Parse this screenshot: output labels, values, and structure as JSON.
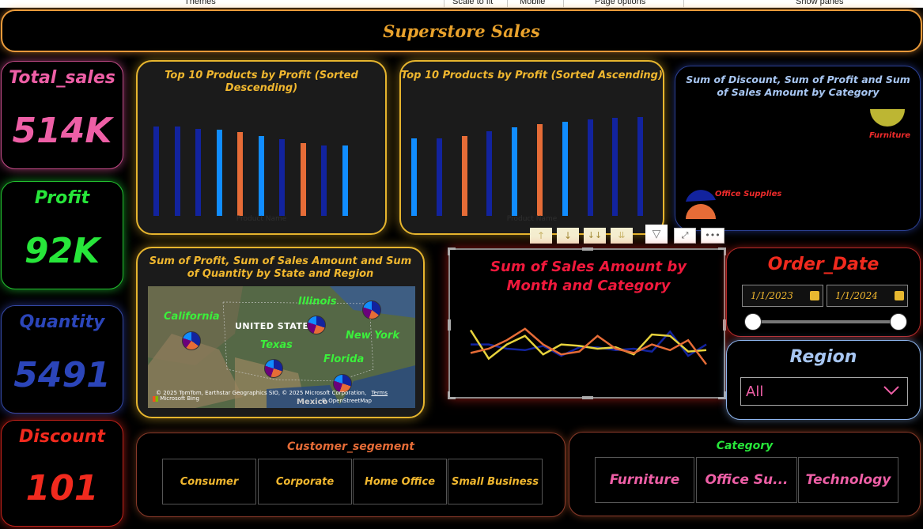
{
  "toolbar": {
    "themes": "Themes",
    "scale_to_fit": "Scale to fit",
    "mobile": "Mobile",
    "page_options": "Page options",
    "show_panes": "Show panes"
  },
  "report_title": "Superstore Sales",
  "kpis": {
    "total_sales": {
      "label": "Total_sales",
      "value": "514K",
      "color": "#ee5fa6"
    },
    "profit": {
      "label": "Profit",
      "value": "92K",
      "color": "#27e63a"
    },
    "quantity": {
      "label": "Quantity",
      "value": "5491",
      "color": "#2b45b9"
    },
    "discount": {
      "label": "Discount",
      "value": "101",
      "color": "#f12a1e"
    }
  },
  "top10_desc": {
    "title": "Top 10 Products by Profit (Sorted Descending)",
    "xlabel": "Product Name"
  },
  "top10_asc": {
    "title": "Top 10 Products by Profit (Sorted Ascending)",
    "xlabel": "Product Name"
  },
  "category_pie": {
    "title": "Sum of Discount, Sum of Profit and Sum of Sales Amount by Category",
    "label_furniture": "Furniture",
    "label_office_supplies": "Office Supplies"
  },
  "map_panel": {
    "title": "Sum of Profit, Sum of Sales Amount and Sum of Quantity by State and Region",
    "states": {
      "california": "California",
      "illinois": "Illinois",
      "texas": "Texas",
      "new_york": "New York",
      "florida": "Florida"
    },
    "country_label": "UNITED STATES",
    "mexico_label": "Mexico",
    "attribution": "© 2025 TomTom, Earthstar Geographics SIO, © 2025 Microsoft Corporation,",
    "terms": "Terms",
    "osm": "© OpenStreetMap",
    "bing": "Microsoft Bing"
  },
  "line_chart": {
    "title": "Sum of Sales Amount by Month and Category"
  },
  "order_date": {
    "label": "Order_Date",
    "start": "1/1/2023",
    "end": "1/1/2024"
  },
  "region": {
    "label": "Region",
    "selected": "All"
  },
  "customer_segment": {
    "label": "Customer_segement",
    "options": [
      "Consumer",
      "Corporate",
      "Home Office",
      "Small Business"
    ]
  },
  "category": {
    "label": "Category",
    "options": [
      "Furniture",
      "Office Su...",
      "Technology"
    ]
  },
  "colors": {
    "dark_blue": "#12239e",
    "light_blue": "#118dff",
    "orange": "#e66c37",
    "yellow": "#e7d33c",
    "gold": "#e6b52e"
  },
  "chart_data": [
    {
      "type": "bar",
      "title": "Top 10 Products by Profit (Sorted Descending)",
      "xlabel": "Product Name",
      "series": [
        {
          "values": [
            7.6,
            7.6,
            7.4,
            7.3,
            7.1,
            6.8,
            6.5,
            6.2,
            6.0,
            6.0
          ]
        }
      ],
      "bar_colors": [
        "#12239e",
        "#12239e",
        "#12239e",
        "#118dff",
        "#e66c37",
        "#118dff",
        "#12239e",
        "#e66c37",
        "#12239e",
        "#118dff"
      ],
      "ylim": [
        0,
        8.4
      ]
    },
    {
      "type": "bar",
      "title": "Top 10 Products by Profit (Sorted Ascending)",
      "xlabel": "Product Name",
      "series": [
        {
          "values": [
            6.6,
            6.6,
            6.8,
            7.2,
            7.5,
            7.8,
            8.0,
            8.2,
            8.3,
            8.4
          ]
        }
      ],
      "bar_colors": [
        "#118dff",
        "#12239e",
        "#e66c37",
        "#12239e",
        "#118dff",
        "#e66c37",
        "#118dff",
        "#12239e",
        "#12239e",
        "#12239e"
      ],
      "ylim": [
        0,
        8.4
      ]
    },
    {
      "type": "line",
      "title": "Sum of Sales Amount by Month and Category",
      "x": [
        1,
        2,
        3,
        4,
        5,
        6,
        7,
        8,
        9,
        10,
        11,
        12,
        13,
        14
      ],
      "series": [
        {
          "color": "#12239e",
          "values": [
            28,
            28,
            25,
            24,
            27,
            20,
            26,
            26,
            24,
            25,
            23,
            37,
            20,
            28
          ]
        },
        {
          "color": "#e7d33c",
          "values": [
            38,
            18,
            28,
            34,
            21,
            28,
            27,
            25,
            26,
            21,
            35,
            34,
            23,
            24
          ]
        },
        {
          "color": "#e66c37",
          "values": [
            22,
            25,
            31,
            39,
            28,
            21,
            23,
            34,
            25,
            22,
            28,
            24,
            31,
            14
          ]
        }
      ],
      "ylim": [
        0,
        50
      ]
    }
  ]
}
